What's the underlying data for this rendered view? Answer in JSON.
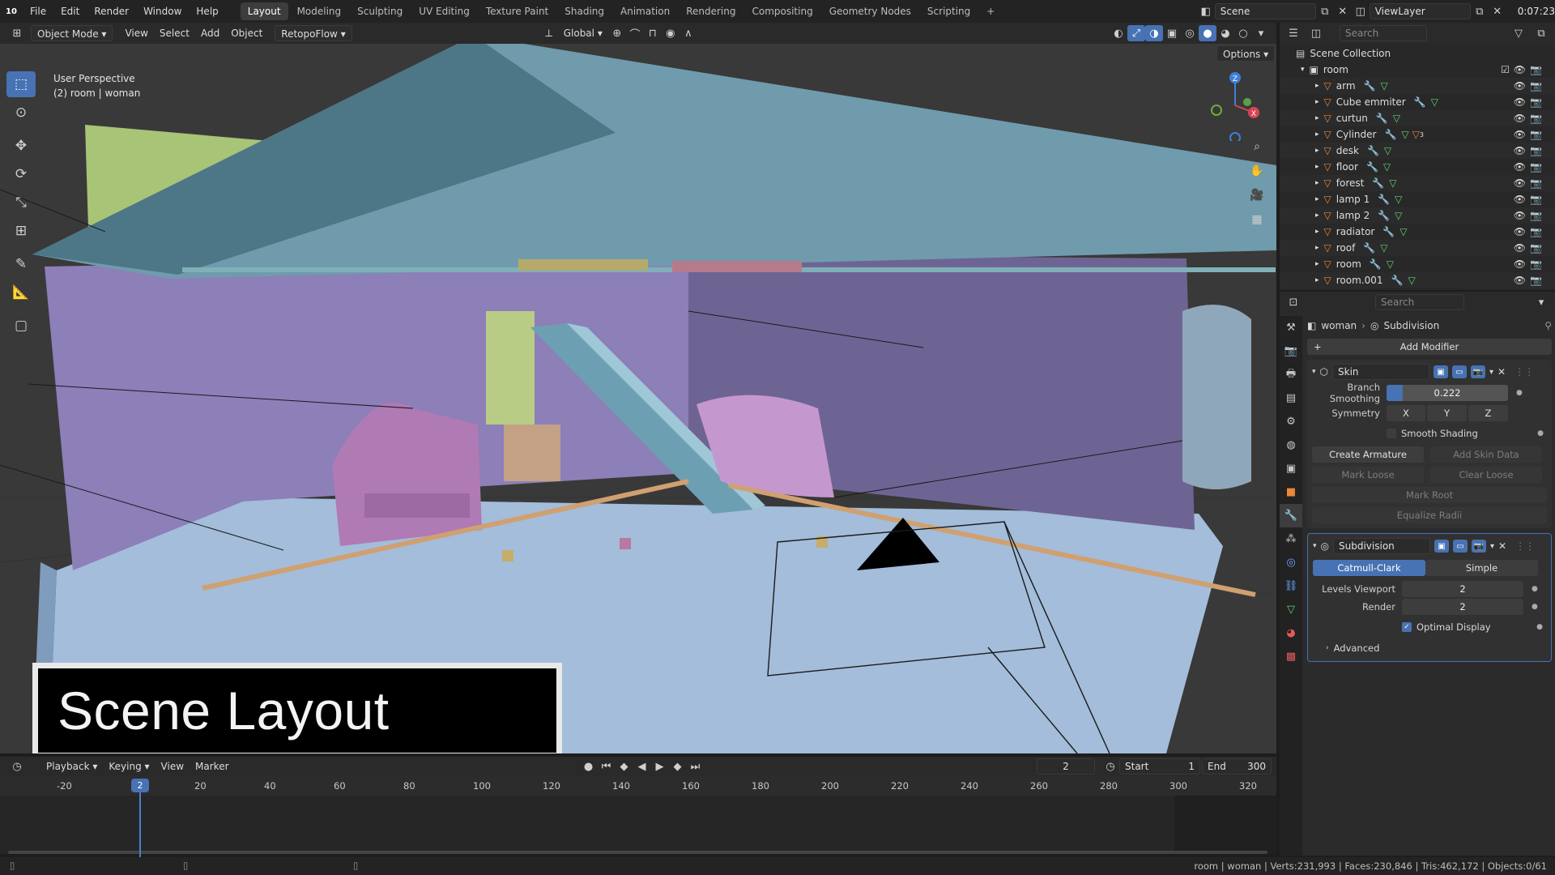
{
  "menubar": {
    "version_icon": "10",
    "menus": [
      "File",
      "Edit",
      "Render",
      "Window",
      "Help"
    ],
    "workspaces": [
      "Layout",
      "Modeling",
      "Sculpting",
      "UV Editing",
      "Texture Paint",
      "Shading",
      "Animation",
      "Rendering",
      "Compositing",
      "Geometry Nodes",
      "Scripting"
    ],
    "active_workspace": "Layout",
    "scene": "Scene",
    "view_layer": "ViewLayer",
    "time": "0:07:23"
  },
  "viewport_header": {
    "mode": "Object Mode",
    "menus": [
      "View",
      "Select",
      "Add",
      "Object"
    ],
    "addon_menu": "RetopoFlow",
    "orientation": "Global",
    "options": "Options"
  },
  "viewport": {
    "perspective": "User Perspective",
    "collection_info": "(2) room | woman",
    "caption": "Scene Layout",
    "gizmo_axes": [
      "Z",
      "X",
      "Y"
    ]
  },
  "outliner": {
    "search_placeholder": "Search",
    "root": "Scene Collection",
    "collection": "room",
    "objects": [
      "arm",
      "Cube emmiter",
      "curtun",
      "Cylinder",
      "desk",
      "floor",
      "forest",
      "lamp 1",
      "lamp 2",
      "radiator",
      "roof",
      "room",
      "room.001"
    ],
    "cylinder_badge": "3"
  },
  "properties": {
    "search_placeholder": "Search",
    "breadcrumb_object": "woman",
    "breadcrumb_modifier": "Subdivision",
    "add_modifier": "Add Modifier",
    "skin": {
      "name": "Skin",
      "branch_smoothing_label": "Branch Smoothing",
      "branch_smoothing_value": "0.222",
      "branch_smoothing_fraction": 0.222,
      "symmetry_label": "Symmetry",
      "symmetry_axes": [
        "X",
        "Y",
        "Z"
      ],
      "smooth_shading": "Smooth Shading",
      "create_armature": "Create Armature",
      "add_skin_data": "Add Skin Data",
      "mark_loose": "Mark Loose",
      "clear_loose": "Clear Loose",
      "mark_root": "Mark Root",
      "equalize_radii": "Equalize Radii"
    },
    "subdivision": {
      "name": "Subdivision",
      "catmull_clark": "Catmull-Clark",
      "simple": "Simple",
      "levels_viewport_label": "Levels Viewport",
      "levels_viewport_value": "2",
      "render_label": "Render",
      "render_value": "2",
      "optimal_display": "Optimal Display",
      "advanced": "Advanced"
    }
  },
  "timeline": {
    "menus": [
      "Playback",
      "Keying",
      "View",
      "Marker"
    ],
    "current_frame": "2",
    "start_label": "Start",
    "start_value": "1",
    "end_label": "End",
    "end_value": "300",
    "ruler_ticks": [
      "-20",
      "20",
      "40",
      "60",
      "80",
      "100",
      "120",
      "140",
      "160",
      "180",
      "200",
      "220",
      "240",
      "260",
      "280",
      "300",
      "320"
    ],
    "playhead_label": "2"
  },
  "status": {
    "text": "room | woman | Verts:231,993 | Faces:230,846 | Tris:462,172 | Objects:0/61"
  },
  "colors": {
    "accent": "#4772b3",
    "wall": "#8f83bb",
    "floor": "#a6c0dd",
    "roof": "#6f9aab"
  }
}
